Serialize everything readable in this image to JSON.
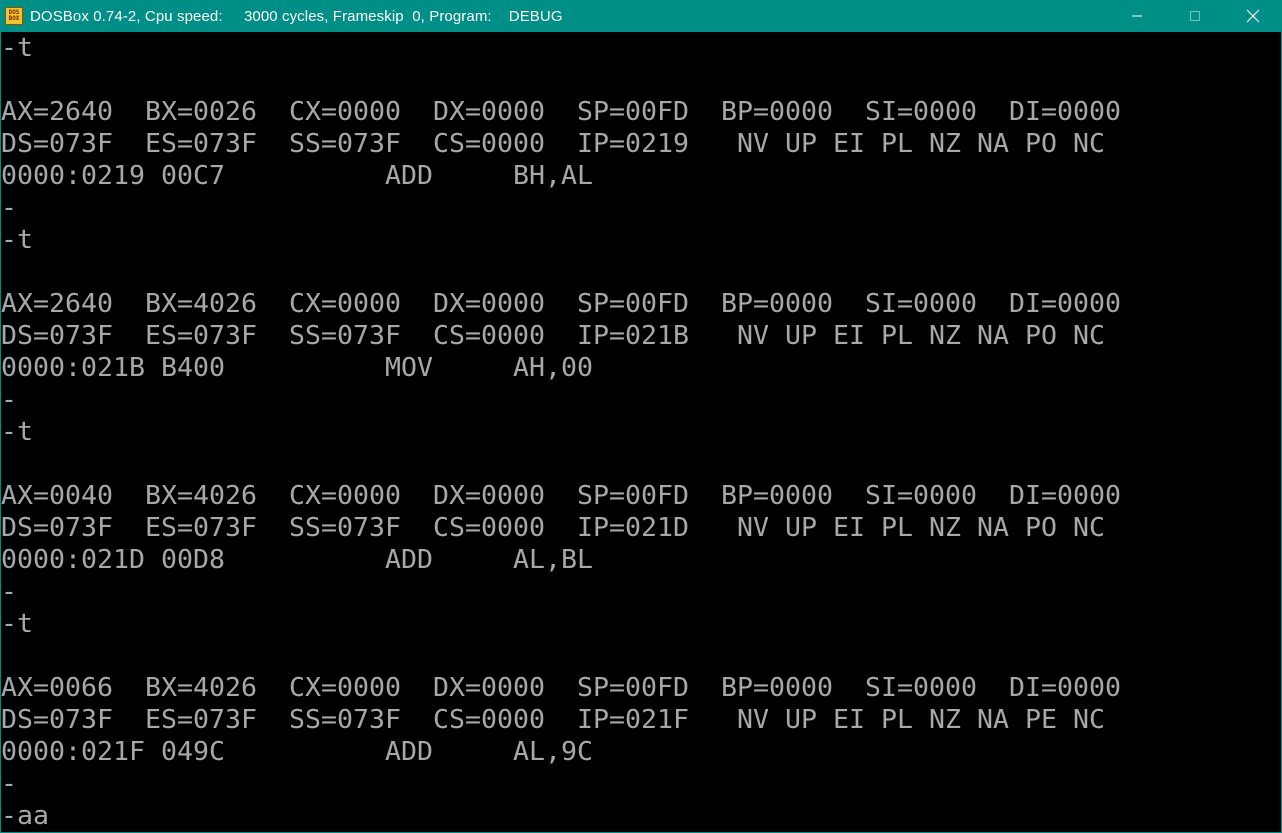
{
  "window": {
    "title": "DOSBox 0.74-2, Cpu speed:     3000 cycles, Frameskip  0, Program:    DEBUG",
    "icon": "dosbox-icon",
    "icon_text_top": "DOS",
    "icon_text_bottom": "BOX",
    "controls": {
      "minimize": "minimize-icon",
      "maximize": "maximize-icon",
      "close": "close-icon"
    }
  },
  "terminal": {
    "lines": [
      "-t",
      "",
      "AX=2640  BX=0026  CX=0000  DX=0000  SP=00FD  BP=0000  SI=0000  DI=0000",
      "DS=073F  ES=073F  SS=073F  CS=0000  IP=0219   NV UP EI PL NZ NA PO NC",
      "0000:0219 00C7          ADD     BH,AL",
      "-",
      "-t",
      "",
      "AX=2640  BX=4026  CX=0000  DX=0000  SP=00FD  BP=0000  SI=0000  DI=0000",
      "DS=073F  ES=073F  SS=073F  CS=0000  IP=021B   NV UP EI PL NZ NA PO NC",
      "0000:021B B400          MOV     AH,00",
      "-",
      "-t",
      "",
      "AX=0040  BX=4026  CX=0000  DX=0000  SP=00FD  BP=0000  SI=0000  DI=0000",
      "DS=073F  ES=073F  SS=073F  CS=0000  IP=021D   NV UP EI PL NZ NA PO NC",
      "0000:021D 00D8          ADD     AL,BL",
      "-",
      "-t",
      "",
      "AX=0066  BX=4026  CX=0000  DX=0000  SP=00FD  BP=0000  SI=0000  DI=0000",
      "DS=073F  ES=073F  SS=073F  CS=0000  IP=021F   NV UP EI PL NZ NA PE NC",
      "0000:021F 049C          ADD     AL,9C",
      "-",
      "-aa"
    ]
  },
  "colors": {
    "titlebar": "#008f86",
    "terminal_bg": "#000000",
    "terminal_text": "#a8a8a8"
  }
}
